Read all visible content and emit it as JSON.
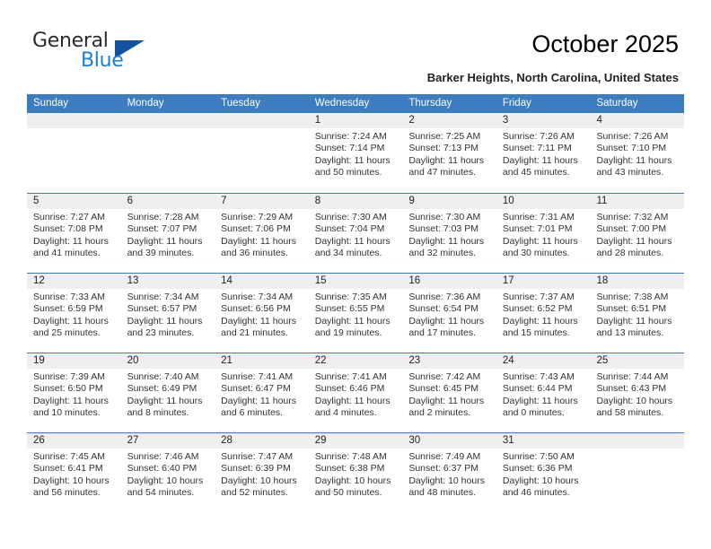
{
  "logo": {
    "primary": "General",
    "secondary": "Blue",
    "flag_icon": "triangle-flag-icon",
    "primary_color": "#2b2b2b",
    "secondary_color": "#1c7fd4",
    "flag_color": "#12529e"
  },
  "header": {
    "title": "October 2025",
    "subtitle": "Barker Heights, North Carolina, United States"
  },
  "theme": {
    "header_bg": "#3b7dc0",
    "header_text": "#ffffff",
    "day_number_bg": "#efefef",
    "cell_bg": "#ffffff",
    "row_divider": "#3b7dc0"
  },
  "calendar": {
    "weekdays": [
      "Sunday",
      "Monday",
      "Tuesday",
      "Wednesday",
      "Thursday",
      "Friday",
      "Saturday"
    ],
    "labels": {
      "sunrise": "Sunrise:",
      "sunset": "Sunset:",
      "daylight": "Daylight:"
    },
    "weeks": [
      [
        {
          "day": "",
          "sunrise": "",
          "sunset": "",
          "daylight": "",
          "empty": true
        },
        {
          "day": "",
          "sunrise": "",
          "sunset": "",
          "daylight": "",
          "empty": true
        },
        {
          "day": "",
          "sunrise": "",
          "sunset": "",
          "daylight": "",
          "empty": true
        },
        {
          "day": "1",
          "sunrise": "Sunrise: 7:24 AM",
          "sunset": "Sunset: 7:14 PM",
          "daylight": "Daylight: 11 hours and 50 minutes."
        },
        {
          "day": "2",
          "sunrise": "Sunrise: 7:25 AM",
          "sunset": "Sunset: 7:13 PM",
          "daylight": "Daylight: 11 hours and 47 minutes."
        },
        {
          "day": "3",
          "sunrise": "Sunrise: 7:26 AM",
          "sunset": "Sunset: 7:11 PM",
          "daylight": "Daylight: 11 hours and 45 minutes."
        },
        {
          "day": "4",
          "sunrise": "Sunrise: 7:26 AM",
          "sunset": "Sunset: 7:10 PM",
          "daylight": "Daylight: 11 hours and 43 minutes."
        }
      ],
      [
        {
          "day": "5",
          "sunrise": "Sunrise: 7:27 AM",
          "sunset": "Sunset: 7:08 PM",
          "daylight": "Daylight: 11 hours and 41 minutes."
        },
        {
          "day": "6",
          "sunrise": "Sunrise: 7:28 AM",
          "sunset": "Sunset: 7:07 PM",
          "daylight": "Daylight: 11 hours and 39 minutes."
        },
        {
          "day": "7",
          "sunrise": "Sunrise: 7:29 AM",
          "sunset": "Sunset: 7:06 PM",
          "daylight": "Daylight: 11 hours and 36 minutes."
        },
        {
          "day": "8",
          "sunrise": "Sunrise: 7:30 AM",
          "sunset": "Sunset: 7:04 PM",
          "daylight": "Daylight: 11 hours and 34 minutes."
        },
        {
          "day": "9",
          "sunrise": "Sunrise: 7:30 AM",
          "sunset": "Sunset: 7:03 PM",
          "daylight": "Daylight: 11 hours and 32 minutes."
        },
        {
          "day": "10",
          "sunrise": "Sunrise: 7:31 AM",
          "sunset": "Sunset: 7:01 PM",
          "daylight": "Daylight: 11 hours and 30 minutes."
        },
        {
          "day": "11",
          "sunrise": "Sunrise: 7:32 AM",
          "sunset": "Sunset: 7:00 PM",
          "daylight": "Daylight: 11 hours and 28 minutes."
        }
      ],
      [
        {
          "day": "12",
          "sunrise": "Sunrise: 7:33 AM",
          "sunset": "Sunset: 6:59 PM",
          "daylight": "Daylight: 11 hours and 25 minutes."
        },
        {
          "day": "13",
          "sunrise": "Sunrise: 7:34 AM",
          "sunset": "Sunset: 6:57 PM",
          "daylight": "Daylight: 11 hours and 23 minutes."
        },
        {
          "day": "14",
          "sunrise": "Sunrise: 7:34 AM",
          "sunset": "Sunset: 6:56 PM",
          "daylight": "Daylight: 11 hours and 21 minutes."
        },
        {
          "day": "15",
          "sunrise": "Sunrise: 7:35 AM",
          "sunset": "Sunset: 6:55 PM",
          "daylight": "Daylight: 11 hours and 19 minutes."
        },
        {
          "day": "16",
          "sunrise": "Sunrise: 7:36 AM",
          "sunset": "Sunset: 6:54 PM",
          "daylight": "Daylight: 11 hours and 17 minutes."
        },
        {
          "day": "17",
          "sunrise": "Sunrise: 7:37 AM",
          "sunset": "Sunset: 6:52 PM",
          "daylight": "Daylight: 11 hours and 15 minutes."
        },
        {
          "day": "18",
          "sunrise": "Sunrise: 7:38 AM",
          "sunset": "Sunset: 6:51 PM",
          "daylight": "Daylight: 11 hours and 13 minutes."
        }
      ],
      [
        {
          "day": "19",
          "sunrise": "Sunrise: 7:39 AM",
          "sunset": "Sunset: 6:50 PM",
          "daylight": "Daylight: 11 hours and 10 minutes."
        },
        {
          "day": "20",
          "sunrise": "Sunrise: 7:40 AM",
          "sunset": "Sunset: 6:49 PM",
          "daylight": "Daylight: 11 hours and 8 minutes."
        },
        {
          "day": "21",
          "sunrise": "Sunrise: 7:41 AM",
          "sunset": "Sunset: 6:47 PM",
          "daylight": "Daylight: 11 hours and 6 minutes."
        },
        {
          "day": "22",
          "sunrise": "Sunrise: 7:41 AM",
          "sunset": "Sunset: 6:46 PM",
          "daylight": "Daylight: 11 hours and 4 minutes."
        },
        {
          "day": "23",
          "sunrise": "Sunrise: 7:42 AM",
          "sunset": "Sunset: 6:45 PM",
          "daylight": "Daylight: 11 hours and 2 minutes."
        },
        {
          "day": "24",
          "sunrise": "Sunrise: 7:43 AM",
          "sunset": "Sunset: 6:44 PM",
          "daylight": "Daylight: 11 hours and 0 minutes."
        },
        {
          "day": "25",
          "sunrise": "Sunrise: 7:44 AM",
          "sunset": "Sunset: 6:43 PM",
          "daylight": "Daylight: 10 hours and 58 minutes."
        }
      ],
      [
        {
          "day": "26",
          "sunrise": "Sunrise: 7:45 AM",
          "sunset": "Sunset: 6:41 PM",
          "daylight": "Daylight: 10 hours and 56 minutes."
        },
        {
          "day": "27",
          "sunrise": "Sunrise: 7:46 AM",
          "sunset": "Sunset: 6:40 PM",
          "daylight": "Daylight: 10 hours and 54 minutes."
        },
        {
          "day": "28",
          "sunrise": "Sunrise: 7:47 AM",
          "sunset": "Sunset: 6:39 PM",
          "daylight": "Daylight: 10 hours and 52 minutes."
        },
        {
          "day": "29",
          "sunrise": "Sunrise: 7:48 AM",
          "sunset": "Sunset: 6:38 PM",
          "daylight": "Daylight: 10 hours and 50 minutes."
        },
        {
          "day": "30",
          "sunrise": "Sunrise: 7:49 AM",
          "sunset": "Sunset: 6:37 PM",
          "daylight": "Daylight: 10 hours and 48 minutes."
        },
        {
          "day": "31",
          "sunrise": "Sunrise: 7:50 AM",
          "sunset": "Sunset: 6:36 PM",
          "daylight": "Daylight: 10 hours and 46 minutes."
        },
        {
          "day": "",
          "sunrise": "",
          "sunset": "",
          "daylight": "",
          "empty": true
        }
      ]
    ]
  }
}
